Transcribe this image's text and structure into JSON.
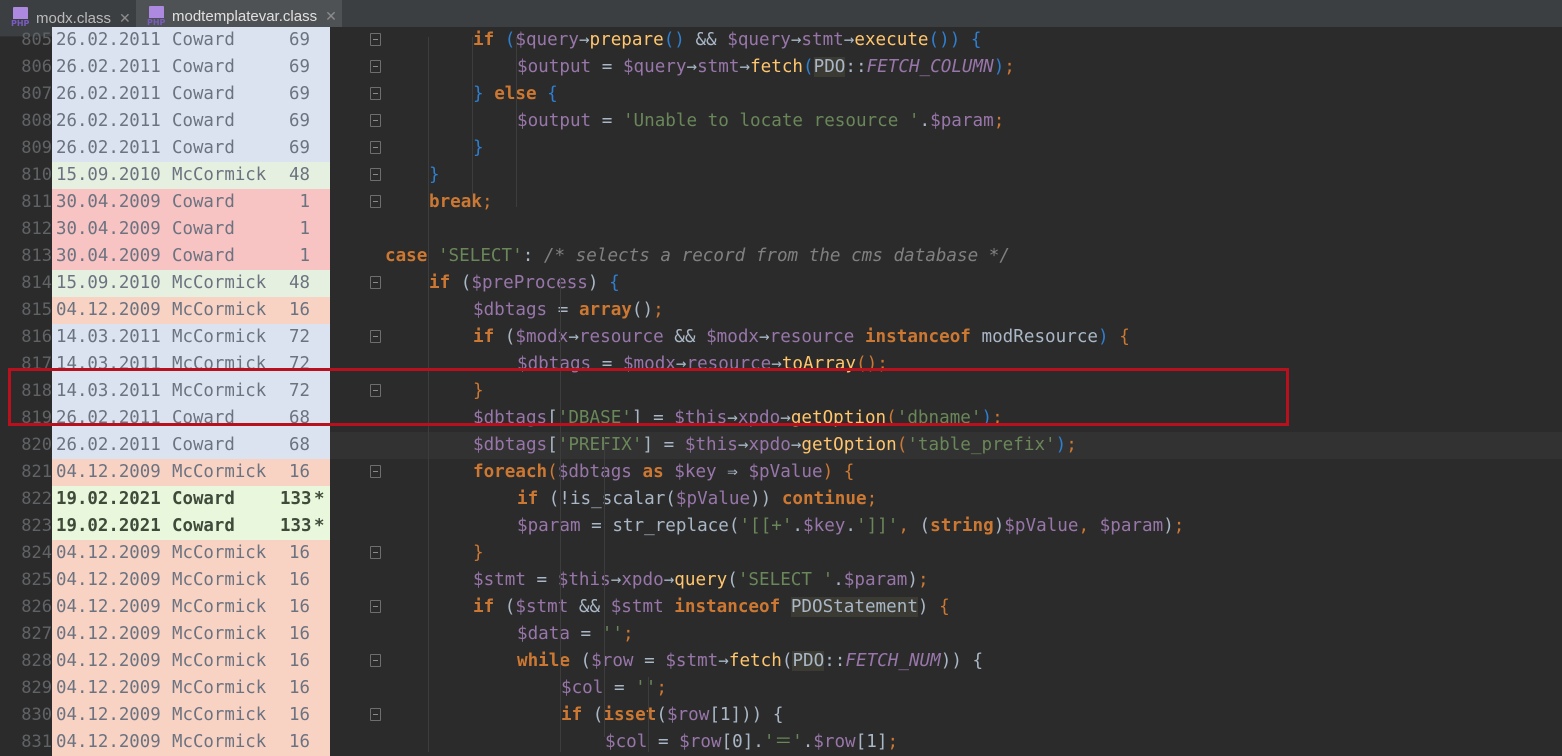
{
  "tabs": [
    {
      "label": "modx.class",
      "icon": "php-file-icon",
      "icon_text": "PHP",
      "active": false
    },
    {
      "label": "modtemplatevar.class",
      "icon": "php-file-icon",
      "icon_text": "PHP",
      "active": true
    }
  ],
  "close_glyph": "✕",
  "colors": {
    "blame_old_blue": "#dce3f0",
    "blame_mid_green": "#e6f0e0",
    "blame_red": "#f7c3c3",
    "blame_orange": "#f8d3c4",
    "blame_new_green": "#e9f7dc",
    "highlight_box": "#b8101c",
    "keyword": "#cc7832",
    "variable": "#9876aa",
    "string": "#6a8759",
    "function": "#ffc66d"
  },
  "lines": [
    {
      "num": "805",
      "date": "26.02.2011",
      "author": "Coward",
      "rev": "69",
      "star": "",
      "bold": false,
      "bg": "#dce3f0",
      "tokens": [
        [
          "kw",
          "if"
        ],
        [
          "op",
          " "
        ],
        [
          "brace",
          "("
        ],
        [
          "var",
          "$query"
        ],
        [
          "op",
          "→"
        ],
        [
          "fn",
          "prepare"
        ],
        [
          "brace",
          "()"
        ],
        [
          "op",
          " && "
        ],
        [
          "var",
          "$query"
        ],
        [
          "op",
          "→"
        ],
        [
          "var",
          "stmt"
        ],
        [
          "op",
          "→"
        ],
        [
          "fn",
          "execute"
        ],
        [
          "brace",
          "()"
        ],
        [
          "brace",
          ")"
        ],
        [
          "op",
          " "
        ],
        [
          "brace",
          "{"
        ]
      ],
      "indent": 4
    },
    {
      "num": "806",
      "date": "26.02.2011",
      "author": "Coward",
      "rev": "69",
      "star": "",
      "bold": false,
      "bg": "#dce3f0",
      "tokens": [
        [
          "var",
          "$output"
        ],
        [
          "op",
          " = "
        ],
        [
          "var",
          "$query"
        ],
        [
          "op",
          "→"
        ],
        [
          "var",
          "stmt"
        ],
        [
          "op",
          "→"
        ],
        [
          "fn",
          "fetch"
        ],
        [
          "brace",
          "("
        ],
        [
          "cls",
          "PDO"
        ],
        [
          "op",
          "::"
        ],
        [
          "cst",
          "FETCH_COLUMN"
        ],
        [
          "brace",
          ")"
        ],
        [
          "semi",
          ";"
        ]
      ],
      "indent": 5
    },
    {
      "num": "807",
      "date": "26.02.2011",
      "author": "Coward",
      "rev": "69",
      "star": "",
      "bold": false,
      "bg": "#dce3f0",
      "tokens": [
        [
          "brace",
          "}"
        ],
        [
          "op",
          " "
        ],
        [
          "kw",
          "else"
        ],
        [
          "op",
          " "
        ],
        [
          "brace",
          "{"
        ]
      ],
      "indent": 4
    },
    {
      "num": "808",
      "date": "26.02.2011",
      "author": "Coward",
      "rev": "69",
      "star": "",
      "bold": false,
      "bg": "#dce3f0",
      "tokens": [
        [
          "var",
          "$output"
        ],
        [
          "op",
          " = "
        ],
        [
          "str",
          "'Unable to locate resource '"
        ],
        [
          "op",
          "."
        ],
        [
          "var",
          "$param"
        ],
        [
          "semi",
          ";"
        ]
      ],
      "indent": 5
    },
    {
      "num": "809",
      "date": "26.02.2011",
      "author": "Coward",
      "rev": "69",
      "star": "",
      "bold": false,
      "bg": "#dce3f0",
      "tokens": [
        [
          "brace",
          "}"
        ]
      ],
      "indent": 4
    },
    {
      "num": "810",
      "date": "15.09.2010",
      "author": "McCormick",
      "rev": "48",
      "star": "",
      "bold": false,
      "bg": "#e6f0e0",
      "tokens": [
        [
          "brace",
          "}"
        ]
      ],
      "indent": 3
    },
    {
      "num": "811",
      "date": "30.04.2009",
      "author": "Coward",
      "rev": "1",
      "star": "",
      "bold": false,
      "bg": "#f7c3c3",
      "tokens": [
        [
          "kw",
          "break"
        ],
        [
          "semi",
          ";"
        ]
      ],
      "indent": 3
    },
    {
      "num": "812",
      "date": "30.04.2009",
      "author": "Coward",
      "rev": "1",
      "star": "",
      "bold": false,
      "bg": "#f7c3c3",
      "tokens": [],
      "indent": 0
    },
    {
      "num": "813",
      "date": "30.04.2009",
      "author": "Coward",
      "rev": "1",
      "star": "",
      "bold": false,
      "bg": "#f7c3c3",
      "tokens": [
        [
          "kw",
          "case"
        ],
        [
          "op",
          " "
        ],
        [
          "str",
          "'SELECT'"
        ],
        [
          "op",
          ": "
        ],
        [
          "cm",
          "/* selects a record from the cms database */"
        ]
      ],
      "indent": 2
    },
    {
      "num": "814",
      "date": "15.09.2010",
      "author": "McCormick",
      "rev": "48",
      "star": "",
      "bold": false,
      "bg": "#e6f0e0",
      "tokens": [
        [
          "kw",
          "if"
        ],
        [
          "op",
          " ("
        ],
        [
          "var",
          "$preProcess"
        ],
        [
          "op",
          ") "
        ],
        [
          "brace",
          "{"
        ]
      ],
      "indent": 3
    },
    {
      "num": "815",
      "date": "04.12.2009",
      "author": "McCormick",
      "rev": "16",
      "star": "",
      "bold": false,
      "bg": "#f8d3c4",
      "tokens": [
        [
          "var",
          "$dbtags"
        ],
        [
          "op",
          " = "
        ],
        [
          "kw",
          "array"
        ],
        [
          "op",
          "()"
        ],
        [
          "semi",
          ";"
        ]
      ],
      "indent": 4
    },
    {
      "num": "816",
      "date": "14.03.2011",
      "author": "McCormick",
      "rev": "72",
      "star": "",
      "bold": false,
      "bg": "#dce3f0",
      "tokens": [
        [
          "kw",
          "if"
        ],
        [
          "op",
          " ("
        ],
        [
          "var",
          "$modx"
        ],
        [
          "op",
          "→"
        ],
        [
          "var",
          "resource"
        ],
        [
          "op",
          " && "
        ],
        [
          "var",
          "$modx"
        ],
        [
          "op",
          "→"
        ],
        [
          "var",
          "resource"
        ],
        [
          "op",
          " "
        ],
        [
          "kw",
          "instanceof"
        ],
        [
          "op",
          " modResource"
        ],
        [
          "brace",
          ")"
        ],
        [
          "op",
          " "
        ],
        [
          "semi",
          "{"
        ]
      ],
      "indent": 4
    },
    {
      "num": "817",
      "date": "14.03.2011",
      "author": "McCormick",
      "rev": "72",
      "star": "",
      "bold": false,
      "bg": "#dce3f0",
      "tokens": [
        [
          "var",
          "$dbtags"
        ],
        [
          "op",
          " = "
        ],
        [
          "var",
          "$modx"
        ],
        [
          "op",
          "→"
        ],
        [
          "var",
          "resource"
        ],
        [
          "op",
          "→"
        ],
        [
          "fn",
          "toArray"
        ],
        [
          "semi",
          "()"
        ],
        [
          "semi",
          ";"
        ]
      ],
      "indent": 5
    },
    {
      "num": "818",
      "date": "14.03.2011",
      "author": "McCormick",
      "rev": "72",
      "star": "",
      "bold": false,
      "bg": "#dce3f0",
      "tokens": [
        [
          "semi",
          "}"
        ]
      ],
      "indent": 4
    },
    {
      "num": "819",
      "date": "26.02.2011",
      "author": "Coward",
      "rev": "68",
      "star": "",
      "bold": false,
      "bg": "#dce3f0",
      "tokens": [
        [
          "var",
          "$dbtags"
        ],
        [
          "op",
          "["
        ],
        [
          "str",
          "'DBASE'"
        ],
        [
          "op",
          "] = "
        ],
        [
          "var",
          "$this"
        ],
        [
          "op",
          "→"
        ],
        [
          "var",
          "xpdo"
        ],
        [
          "op",
          "→"
        ],
        [
          "fn",
          "getOption"
        ],
        [
          "semi",
          "("
        ],
        [
          "str",
          "'dbname'"
        ],
        [
          "brace",
          ")"
        ],
        [
          "semi",
          ";"
        ]
      ],
      "indent": 4
    },
    {
      "num": "820",
      "date": "26.02.2011",
      "author": "Coward",
      "rev": "68",
      "star": "",
      "bold": false,
      "bg": "#dce3f0",
      "current": true,
      "tokens": [
        [
          "var",
          "$dbtags"
        ],
        [
          "op",
          "["
        ],
        [
          "str",
          "'PREFIX'"
        ],
        [
          "op",
          "] = "
        ],
        [
          "var",
          "$this"
        ],
        [
          "op",
          "→"
        ],
        [
          "var",
          "xpdo"
        ],
        [
          "op",
          "→"
        ],
        [
          "fn",
          "getOption"
        ],
        [
          "semi",
          "("
        ],
        [
          "str",
          "'table_prefix'"
        ],
        [
          "brace",
          ")"
        ],
        [
          "semi",
          ";"
        ]
      ],
      "indent": 4
    },
    {
      "num": "821",
      "date": "04.12.2009",
      "author": "McCormick",
      "rev": "16",
      "star": "",
      "bold": false,
      "bg": "#f8d3c4",
      "tokens": [
        [
          "kw",
          "foreach"
        ],
        [
          "semi",
          "("
        ],
        [
          "var",
          "$dbtags"
        ],
        [
          "op",
          " "
        ],
        [
          "kw",
          "as"
        ],
        [
          "op",
          " "
        ],
        [
          "var",
          "$key"
        ],
        [
          "op",
          " ⇒ "
        ],
        [
          "var",
          "$pValue"
        ],
        [
          "semi",
          ")"
        ],
        [
          "op",
          " "
        ],
        [
          "semi",
          "{"
        ]
      ],
      "indent": 4
    },
    {
      "num": "822",
      "date": "19.02.2021",
      "author": "Coward",
      "rev": "133",
      "star": "*",
      "bold": true,
      "bg": "#e9f7dc",
      "tokens": [
        [
          "kw",
          "if"
        ],
        [
          "op",
          " (!is_scalar("
        ],
        [
          "var",
          "$pValue"
        ],
        [
          "op",
          ")) "
        ],
        [
          "kw",
          "continue"
        ],
        [
          "semi",
          ";"
        ]
      ],
      "indent": 5
    },
    {
      "num": "823",
      "date": "19.02.2021",
      "author": "Coward",
      "rev": "133",
      "star": "*",
      "bold": true,
      "bg": "#e9f7dc",
      "tokens": [
        [
          "var",
          "$param"
        ],
        [
          "op",
          " = str_replace("
        ],
        [
          "str",
          "'[[+'"
        ],
        [
          "op",
          "."
        ],
        [
          "var",
          "$key"
        ],
        [
          "op",
          "."
        ],
        [
          "str",
          "']]'"
        ],
        [
          "semi",
          ", "
        ],
        [
          "op",
          "("
        ],
        [
          "kw",
          "string"
        ],
        [
          "op",
          ")"
        ],
        [
          "var",
          "$pValue"
        ],
        [
          "semi",
          ", "
        ],
        [
          "var",
          "$param"
        ],
        [
          "op",
          ")"
        ],
        [
          "semi",
          ";"
        ]
      ],
      "indent": 5
    },
    {
      "num": "824",
      "date": "04.12.2009",
      "author": "McCormick",
      "rev": "16",
      "star": "",
      "bold": false,
      "bg": "#f8d3c4",
      "tokens": [
        [
          "semi",
          "}"
        ]
      ],
      "indent": 4
    },
    {
      "num": "825",
      "date": "04.12.2009",
      "author": "McCormick",
      "rev": "16",
      "star": "",
      "bold": false,
      "bg": "#f8d3c4",
      "tokens": [
        [
          "var",
          "$stmt"
        ],
        [
          "op",
          " = "
        ],
        [
          "var",
          "$this"
        ],
        [
          "op",
          "→"
        ],
        [
          "var",
          "xpdo"
        ],
        [
          "op",
          "→"
        ],
        [
          "fn",
          "query"
        ],
        [
          "op",
          "("
        ],
        [
          "str",
          "'SELECT '"
        ],
        [
          "op",
          "."
        ],
        [
          "var",
          "$param"
        ],
        [
          "op",
          ")"
        ],
        [
          "semi",
          ";"
        ]
      ],
      "indent": 4
    },
    {
      "num": "826",
      "date": "04.12.2009",
      "author": "McCormick",
      "rev": "16",
      "star": "",
      "bold": false,
      "bg": "#f8d3c4",
      "tokens": [
        [
          "kw",
          "if"
        ],
        [
          "op",
          " ("
        ],
        [
          "var",
          "$stmt"
        ],
        [
          "op",
          " && "
        ],
        [
          "var",
          "$stmt"
        ],
        [
          "op",
          " "
        ],
        [
          "kw",
          "instanceof"
        ],
        [
          "op",
          " "
        ],
        [
          "cls",
          "PDOStatement"
        ],
        [
          "op",
          ") "
        ],
        [
          "semi",
          "{"
        ]
      ],
      "indent": 4
    },
    {
      "num": "827",
      "date": "04.12.2009",
      "author": "McCormick",
      "rev": "16",
      "star": "",
      "bold": false,
      "bg": "#f8d3c4",
      "tokens": [
        [
          "var",
          "$data"
        ],
        [
          "op",
          " = "
        ],
        [
          "str",
          "''"
        ],
        [
          "semi",
          ";"
        ]
      ],
      "indent": 5
    },
    {
      "num": "828",
      "date": "04.12.2009",
      "author": "McCormick",
      "rev": "16",
      "star": "",
      "bold": false,
      "bg": "#f8d3c4",
      "tokens": [
        [
          "kw",
          "while"
        ],
        [
          "op",
          " ("
        ],
        [
          "var",
          "$row"
        ],
        [
          "op",
          " = "
        ],
        [
          "var",
          "$stmt"
        ],
        [
          "op",
          "→"
        ],
        [
          "fn",
          "fetch"
        ],
        [
          "op",
          "("
        ],
        [
          "cls",
          "PDO"
        ],
        [
          "op",
          "::"
        ],
        [
          "cst",
          "FETCH_NUM"
        ],
        [
          "op",
          ")) {"
        ]
      ],
      "indent": 5
    },
    {
      "num": "829",
      "date": "04.12.2009",
      "author": "McCormick",
      "rev": "16",
      "star": "",
      "bold": false,
      "bg": "#f8d3c4",
      "tokens": [
        [
          "var",
          "$col"
        ],
        [
          "op",
          " = "
        ],
        [
          "str",
          "''"
        ],
        [
          "semi",
          ";"
        ]
      ],
      "indent": 6
    },
    {
      "num": "830",
      "date": "04.12.2009",
      "author": "McCormick",
      "rev": "16",
      "star": "",
      "bold": false,
      "bg": "#f8d3c4",
      "tokens": [
        [
          "kw",
          "if"
        ],
        [
          "op",
          " ("
        ],
        [
          "kw",
          "isset"
        ],
        [
          "op",
          "("
        ],
        [
          "var",
          "$row"
        ],
        [
          "op",
          "[1])) {"
        ]
      ],
      "indent": 6
    },
    {
      "num": "831",
      "date": "04.12.2009",
      "author": "McCormick",
      "rev": "16",
      "star": "",
      "bold": false,
      "bg": "#f8d3c4",
      "tokens": [
        [
          "var",
          "$col"
        ],
        [
          "op",
          " = "
        ],
        [
          "var",
          "$row"
        ],
        [
          "op",
          "[0]."
        ],
        [
          "str",
          "'＝'"
        ],
        [
          "op",
          "."
        ],
        [
          "var",
          "$row"
        ],
        [
          "op",
          "[1]"
        ],
        [
          "semi",
          ";"
        ]
      ],
      "indent": 7
    }
  ]
}
